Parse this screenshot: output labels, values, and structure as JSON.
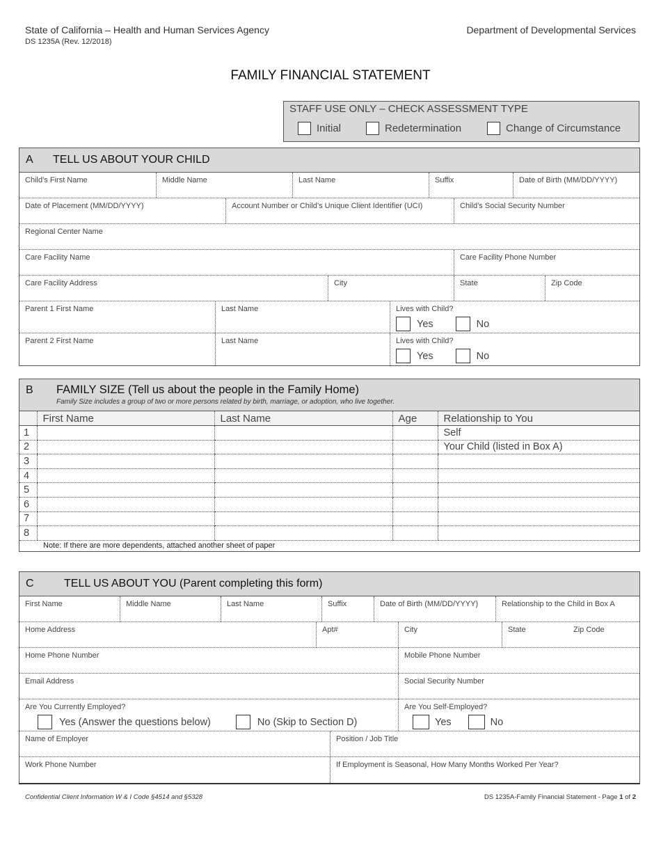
{
  "header": {
    "agency": "State of California – Health and Human Services Agency",
    "form_number": "DS 1235A (Rev. 12/2018)",
    "department": "Department of Developmental Services"
  },
  "title": "FAMILY FINANCIAL STATEMENT",
  "staff_use": {
    "title": "STAFF USE ONLY – CHECK ASSESSMENT TYPE",
    "options": [
      "Initial",
      "Redetermination",
      "Change of Circumstance"
    ]
  },
  "section_a": {
    "letter": "A",
    "title": "TELL US ABOUT YOUR CHILD",
    "row1": [
      "Child’s First Name",
      "Middle Name",
      "Last Name",
      "Suffix",
      "Date of Birth (MM/DD/YYYY)"
    ],
    "row2": [
      "Date of Placement (MM/DD/YYYY)",
      "Account Number or Child’s Unique Client Identifier (UCI)",
      "Child’s Social Security Number"
    ],
    "row3": [
      "Regional Center Name"
    ],
    "row4": [
      "Care Facility Name",
      "Care Facility Phone Number"
    ],
    "row5": [
      "Care Facility Address",
      "City",
      "State",
      "Zip Code"
    ],
    "parent1": {
      "first": "Parent 1 First Name",
      "last": "Last Name",
      "lives": "Lives with Child?",
      "yes": "Yes",
      "no": "No"
    },
    "parent2": {
      "first": "Parent 2 First Name",
      "last": "Last Name",
      "lives": "Lives with Child?",
      "yes": "Yes",
      "no": "No"
    }
  },
  "section_b": {
    "letter": "B",
    "title": "FAMILY SIZE (Tell us about the people in the Family Home)",
    "subtitle": "Family Size includes a group of two or more persons related by birth, marriage, or adoption, who live together.",
    "columns": [
      "",
      "First Name",
      "Last Name",
      "Age",
      "Relationship to You"
    ],
    "rows": [
      {
        "num": "1",
        "first": "",
        "last": "",
        "age": "",
        "relationship": "Self"
      },
      {
        "num": "2",
        "first": "",
        "last": "",
        "age": "",
        "relationship": "Your Child (listed in Box A)"
      },
      {
        "num": "3",
        "first": "",
        "last": "",
        "age": "",
        "relationship": ""
      },
      {
        "num": "4",
        "first": "",
        "last": "",
        "age": "",
        "relationship": ""
      },
      {
        "num": "5",
        "first": "",
        "last": "",
        "age": "",
        "relationship": ""
      },
      {
        "num": "6",
        "first": "",
        "last": "",
        "age": "",
        "relationship": ""
      },
      {
        "num": "7",
        "first": "",
        "last": "",
        "age": "",
        "relationship": ""
      },
      {
        "num": "8",
        "first": "",
        "last": "",
        "age": "",
        "relationship": ""
      }
    ],
    "note": "Note: If there are more dependents, attached another sheet of paper"
  },
  "section_c": {
    "letter": "C",
    "title": "TELL US ABOUT YOU (Parent completing this form)",
    "row1": [
      "First Name",
      "Middle Name",
      "Last Name",
      "Suffix",
      "Date of Birth (MM/DD/YYYY)",
      "Relationship to the Child in Box A"
    ],
    "row2": [
      "Home Address",
      "Apt#",
      "City",
      "State",
      "Zip Code"
    ],
    "row3": [
      "Home Phone Number",
      "Mobile Phone Number"
    ],
    "row4": [
      "Email Address",
      "Social Security Number"
    ],
    "employed": {
      "label": "Are You Currently Employed?",
      "yes": "Yes (Answer the questions below)",
      "no": "No (Skip to Section D)"
    },
    "self_employed": {
      "label": "Are You Self-Employed?",
      "yes": "Yes",
      "no": "No"
    },
    "row6": [
      "Name of Employer",
      "Position / Job Title"
    ],
    "row7": [
      "Work Phone Number",
      "If Employment is Seasonal, How Many Months Worked Per Year?"
    ]
  },
  "footer": {
    "left": "Confidential Client Information W & I Code §4514 and §5328",
    "right_prefix": "DS 1235A-Family Financial Statement - Page ",
    "page": "1",
    "of": " of ",
    "total": "2"
  }
}
